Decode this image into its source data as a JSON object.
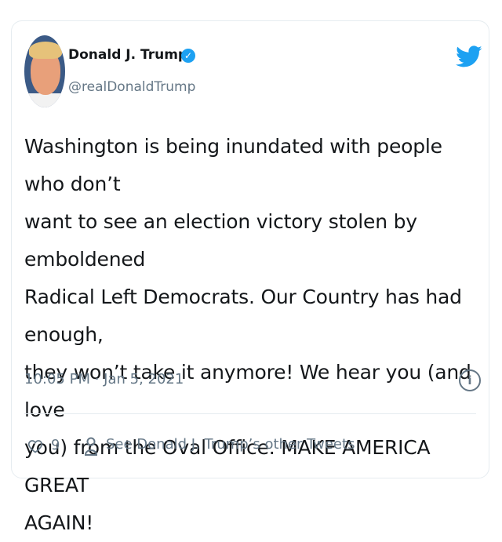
{
  "tweet": {
    "author_name": "Donald J. Trump",
    "author_handle": "@realDonaldTrump",
    "verified_mark": "✓",
    "text": "Washington is being inundated with people who don’t\nwant to see an election victory stolen by emboldened\nRadical Left Democrats. Our Country has had enough,\nthey won’t take it anymore! We hear you (and love\nyou) from the Oval Office. MAKE AMERICA GREAT\nAGAIN!",
    "timestamp": "10:05 PM · Jan 5, 2021",
    "like_count": "9",
    "other_tweets_link": "See Donald J. Trump’s other Tweets",
    "info_glyph": "i"
  },
  "icons": {
    "avatar": "profile-photo",
    "verified": "verified-badge-icon",
    "brand": "twitter-bird-icon",
    "info": "info-icon",
    "like": "heart-icon",
    "user": "person-icon"
  },
  "colors": {
    "accent": "#1da1f2",
    "text": "#14171a",
    "muted": "#657786",
    "border": "#e6ecf0"
  }
}
